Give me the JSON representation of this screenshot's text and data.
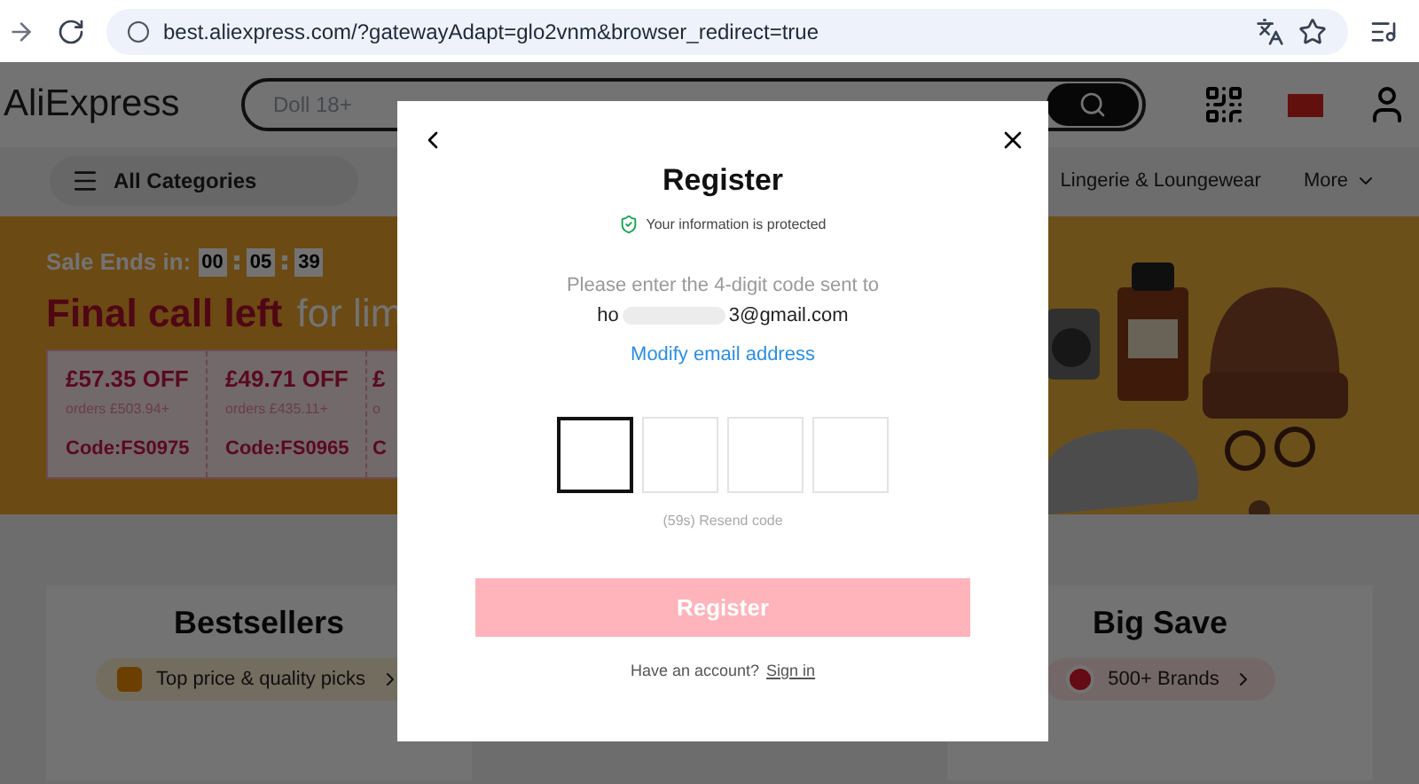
{
  "browser": {
    "url": "best.aliexpress.com/?gatewayAdapt=glo2vnm&browser_redirect=true"
  },
  "header": {
    "logo": "AliExpress",
    "search_placeholder": "Doll 18+"
  },
  "nav": {
    "all_categories": "All Categories",
    "items": [
      "Lingerie & Loungewear"
    ],
    "more": "More"
  },
  "banner": {
    "sale_label": "Sale Ends in:",
    "timer": [
      "00",
      "05",
      "39"
    ],
    "headline_bold": "Final call left",
    "headline_rest": "for lim",
    "coupons": [
      {
        "amount": "£57.35 OFF",
        "orders": "orders  £503.94+",
        "code": "Code:FS0975"
      },
      {
        "amount": "£49.71 OFF",
        "orders": "orders  £435.11+",
        "code": "Code:FS0965"
      },
      {
        "amount": "£",
        "orders": "o",
        "code": "C"
      }
    ]
  },
  "cards": [
    {
      "title": "Bestsellers",
      "pill": "Top price & quality picks",
      "kind": "bag"
    },
    {
      "title": "Big Save",
      "pill": "500+ Brands",
      "kind": "brand"
    }
  ],
  "modal": {
    "title": "Register",
    "protected": "Your information is protected",
    "prompt": "Please enter the 4-digit code sent to",
    "email_start": "ho",
    "email_end": "3@gmail.com",
    "modify_link": "Modify email address",
    "code_boxes": [
      {
        "focused": true
      },
      {
        "focused": false
      },
      {
        "focused": false
      },
      {
        "focused": false
      }
    ],
    "resend": "(59s) Resend code",
    "submit": "Register",
    "submit_disabled": true,
    "account_prompt": "Have an account?",
    "sign_in": "Sign in"
  }
}
